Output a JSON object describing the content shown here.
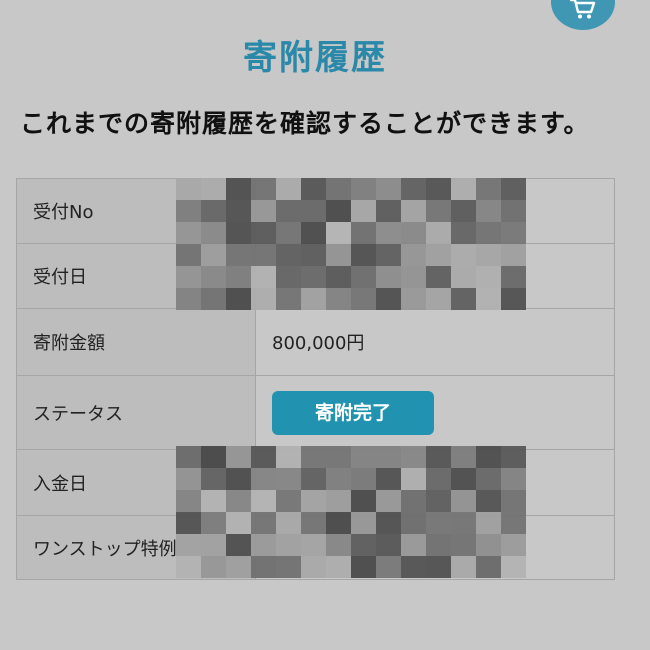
{
  "page": {
    "title": "寄附履歴",
    "description": "これまでの寄附履歴を確認することができます。"
  },
  "header": {
    "cart_icon": "cart-icon"
  },
  "table": {
    "rows": [
      {
        "label": "受付No",
        "value": ""
      },
      {
        "label": "受付日",
        "value": ""
      },
      {
        "label": "寄附金額",
        "value": "800,000円"
      },
      {
        "label": "ステータス",
        "status": "寄附完了"
      },
      {
        "label": "入金日",
        "value": ""
      },
      {
        "label": "ワンストップ特例",
        "value": ""
      }
    ]
  },
  "colors": {
    "accent": "#2a88a8",
    "status_badge": "#2193b0",
    "label_cell": "#bdbdbd",
    "overlay_background": "#c8c8c8"
  }
}
